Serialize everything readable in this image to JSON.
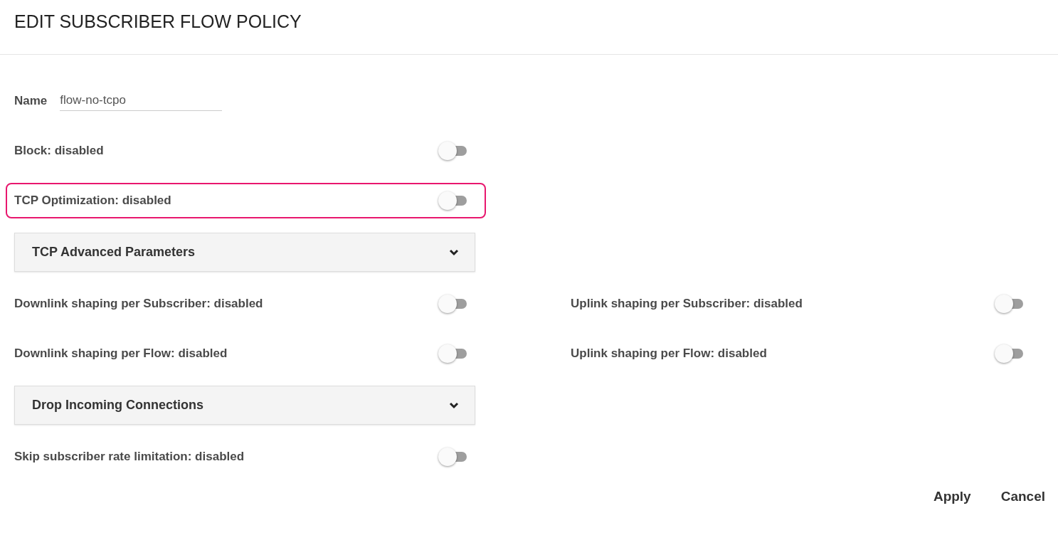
{
  "title": "EDIT SUBSCRIBER FLOW POLICY",
  "name_field": {
    "label": "Name",
    "value": "flow-no-tcpo"
  },
  "sections": [
    {
      "kind": "toggle",
      "label": "Block: disabled",
      "on": false,
      "highlighted": false
    },
    {
      "kind": "toggle",
      "label": "TCP Optimization: disabled",
      "on": false,
      "highlighted": true
    },
    {
      "kind": "panel",
      "label": "TCP Advanced Parameters",
      "expanded": false
    },
    {
      "kind": "pair",
      "items": [
        {
          "label": "Downlink shaping per Subscriber: disabled",
          "on": false
        },
        {
          "label": "Uplink shaping per Subscriber: disabled",
          "on": false
        }
      ]
    },
    {
      "kind": "pair",
      "items": [
        {
          "label": "Downlink shaping per Flow: disabled",
          "on": false
        },
        {
          "label": "Uplink shaping per Flow: disabled",
          "on": false
        }
      ]
    },
    {
      "kind": "panel",
      "label": "Drop Incoming Connections",
      "expanded": false
    },
    {
      "kind": "toggle",
      "label": "Skip subscriber rate limitation: disabled",
      "on": false,
      "highlighted": false
    }
  ],
  "buttons": [
    "Apply",
    "Cancel"
  ]
}
